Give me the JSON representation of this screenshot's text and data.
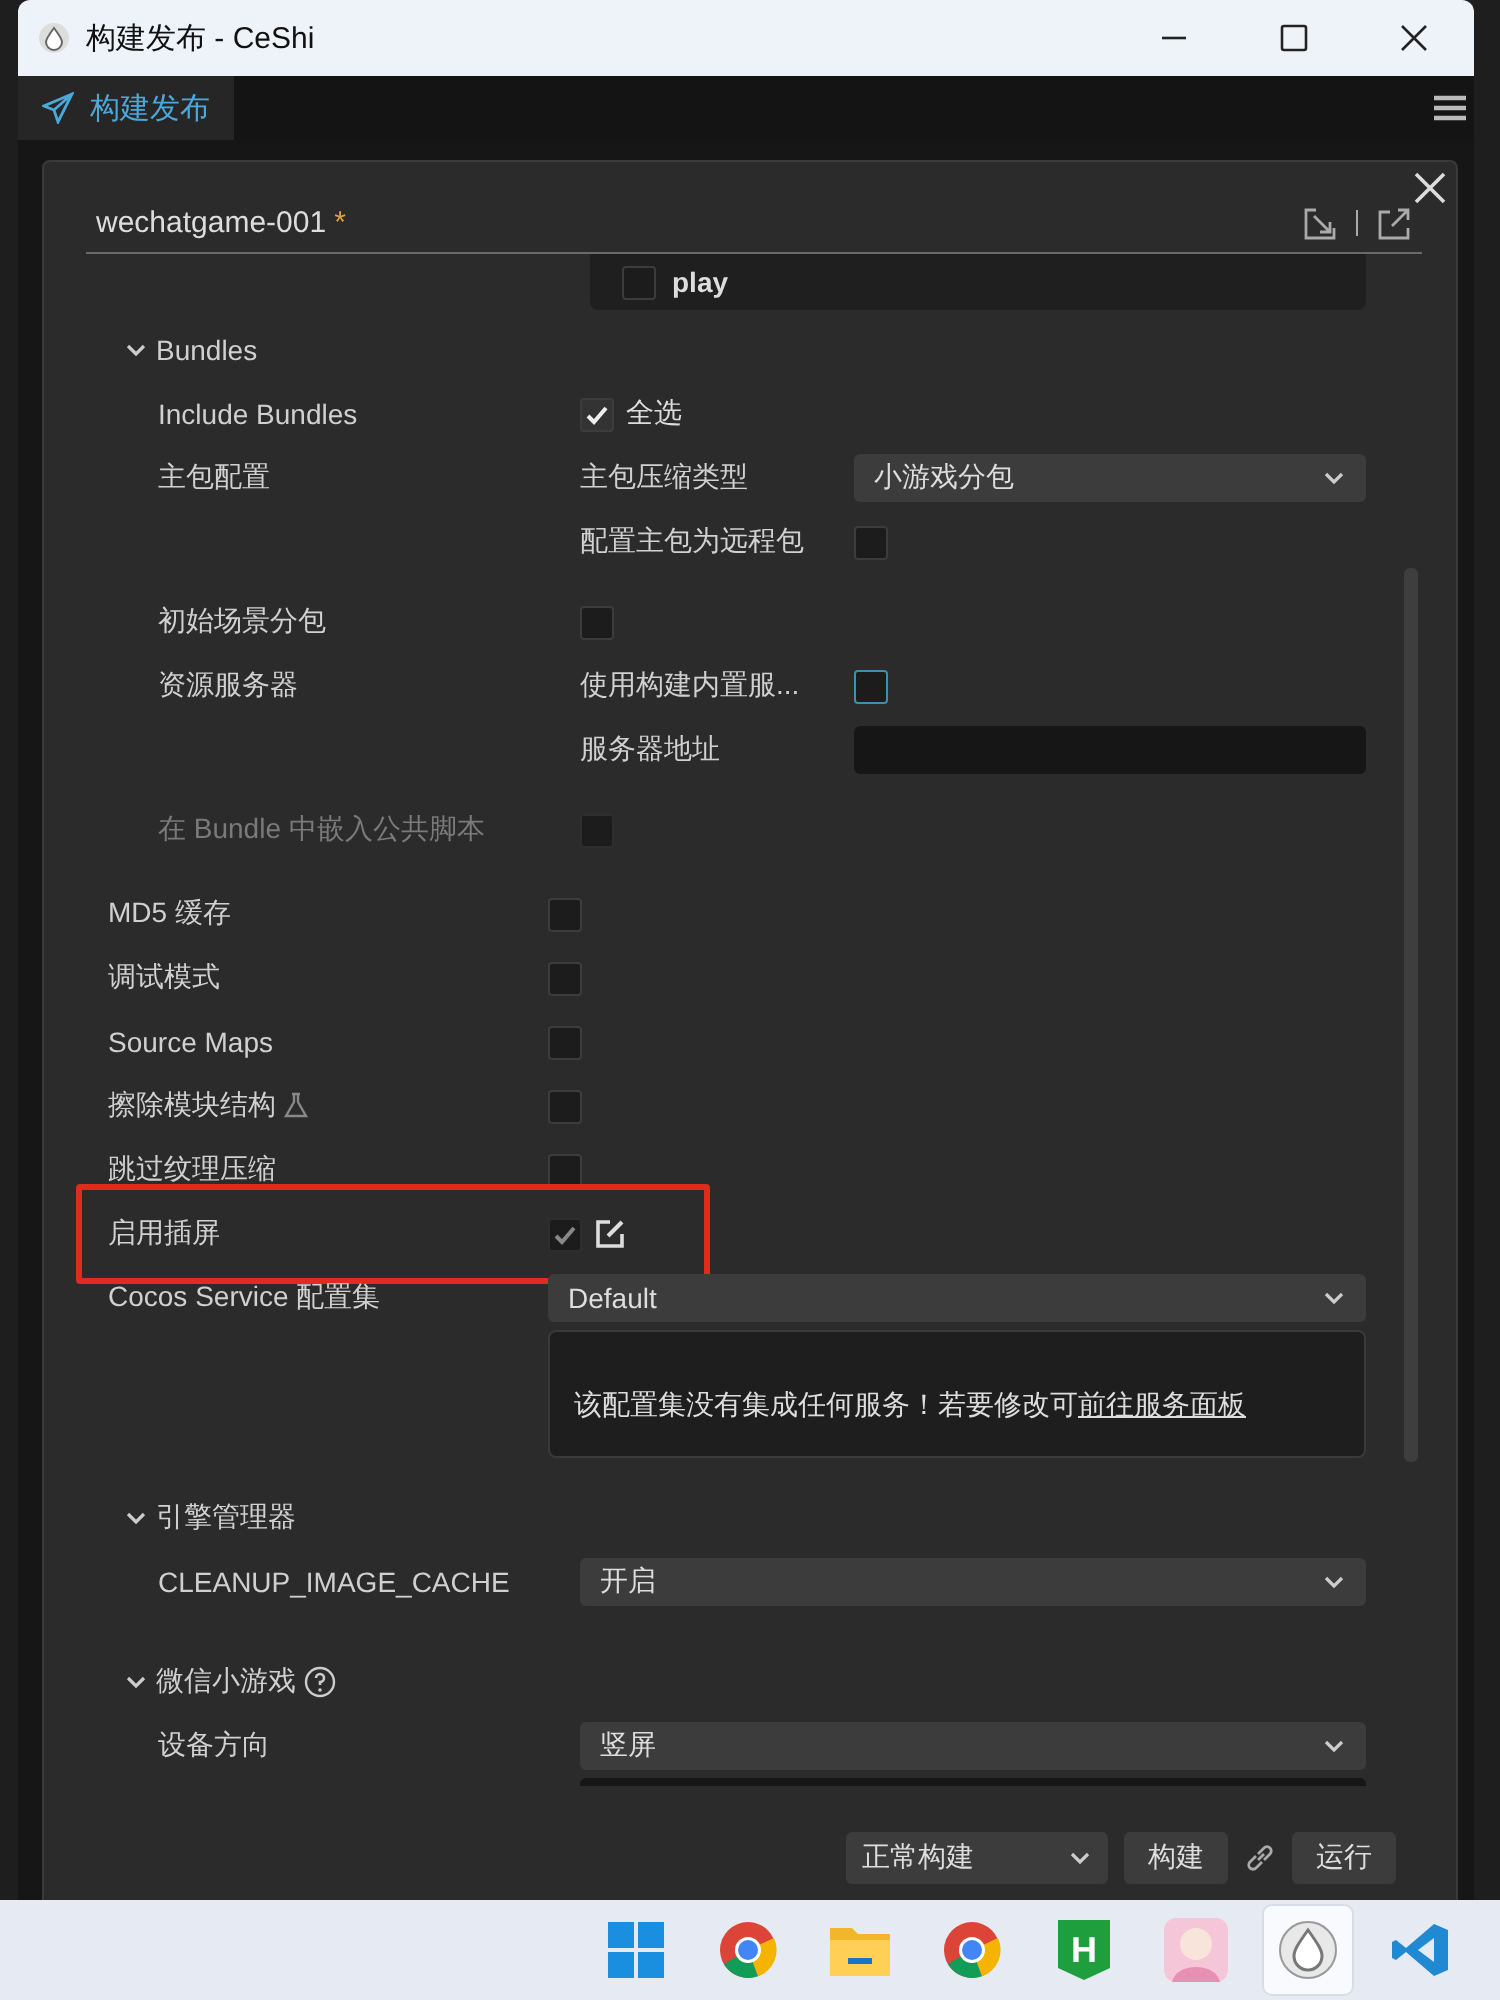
{
  "window": {
    "title": "构建发布 - CeShi"
  },
  "tab": {
    "label": "构建发布",
    "selected": true
  },
  "panel": {
    "title": "wechatgame-001",
    "modified_mark": "*"
  },
  "scene_list": {
    "items": [
      {
        "name": "play",
        "checked": false
      }
    ]
  },
  "bundles": {
    "title": "Bundles",
    "expanded": true,
    "rows": [
      {
        "label": "Include Bundles",
        "controls": [
          {
            "kind": "check",
            "checked": true,
            "text": "全选"
          }
        ]
      },
      {
        "label": "主包配置",
        "controls": [
          {
            "kind": "select",
            "label": "主包压缩类型",
            "value": "小游戏分包"
          },
          {
            "kind": "check",
            "label": "配置主包为远程包",
            "checked": false
          }
        ]
      },
      {
        "label": "初始场景分包",
        "controls": [
          {
            "kind": "check",
            "checked": false
          }
        ]
      },
      {
        "label": "资源服务器",
        "controls": [
          {
            "kind": "check",
            "label": "使用构建内置服...",
            "checked": false,
            "focused": true
          },
          {
            "kind": "field",
            "label": "服务器地址"
          }
        ]
      },
      {
        "label": "在 Bundle 中嵌入公共脚本",
        "disabled": true,
        "controls": [
          {
            "kind": "check",
            "checked": false,
            "disabled": true
          }
        ]
      }
    ]
  },
  "options": [
    {
      "label": "MD5 缓存",
      "controls": [
        {
          "kind": "check",
          "checked": false
        }
      ]
    },
    {
      "label": "调试模式",
      "controls": [
        {
          "kind": "check",
          "checked": false
        }
      ]
    },
    {
      "label": "Source Maps",
      "controls": [
        {
          "kind": "check",
          "checked": false
        }
      ]
    },
    {
      "label": "擦除模块结构",
      "experimental": true,
      "controls": [
        {
          "kind": "check",
          "checked": false
        }
      ]
    },
    {
      "label": "跳过纹理压缩",
      "controls": [
        {
          "kind": "check",
          "checked": false
        }
      ]
    },
    {
      "label": "启用插屏",
      "highlighted": true,
      "controls": [
        {
          "kind": "check",
          "checked": true,
          "disabled": true,
          "edit": true
        }
      ]
    },
    {
      "label": "Cocos Service 配置集",
      "controls": [
        {
          "kind": "select",
          "value": "Default"
        },
        {
          "kind": "note",
          "text": "该配置集没有集成任何服务！若要修改可",
          "link": "前往服务面板"
        }
      ]
    }
  ],
  "engine": {
    "title": "引擎管理器",
    "expanded": true,
    "rows": [
      {
        "label": "CLEANUP_IMAGE_CACHE",
        "controls": [
          {
            "kind": "select",
            "value": "开启"
          }
        ]
      }
    ]
  },
  "wechat": {
    "title": "微信小游戏",
    "expanded": true,
    "help": true,
    "rows": [
      {
        "label": "设备方向",
        "controls": [
          {
            "kind": "select",
            "value": "竖屏"
          },
          {
            "kind": "field"
          }
        ]
      }
    ]
  },
  "footer": {
    "mode": "正常构建",
    "buttons": [
      "构建",
      "运行"
    ]
  },
  "taskbar": {
    "apps": [
      {
        "kind": "start",
        "selected": false
      },
      {
        "kind": "chrome",
        "selected": false
      },
      {
        "kind": "folder",
        "selected": false
      },
      {
        "kind": "chrome",
        "selected": false
      },
      {
        "kind": "hbuilder",
        "label": "H",
        "selected": false
      },
      {
        "kind": "avatar",
        "selected": false
      },
      {
        "kind": "cocos",
        "selected": true
      },
      {
        "kind": "vscode",
        "selected": false
      }
    ]
  }
}
